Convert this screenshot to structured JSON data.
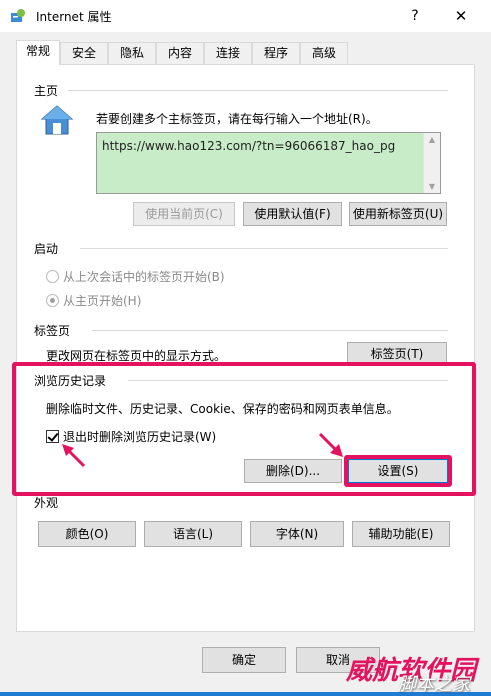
{
  "window": {
    "title": "Internet 属性",
    "help": "?",
    "close": "✕"
  },
  "tabs": [
    "常规",
    "安全",
    "隐私",
    "内容",
    "连接",
    "程序",
    "高级"
  ],
  "homepage": {
    "label": "主页",
    "instructions": "若要创建多个主标签页，请在每行输入一个地址(R)。",
    "url": "https://www.hao123.com/?tn=96066187_hao_pg",
    "btn_current": "使用当前页(C)",
    "btn_default": "使用默认值(F)",
    "btn_newtab": "使用新标签页(U)"
  },
  "startup": {
    "label": "启动",
    "opt1": "从上次会话中的标签页开始(B)",
    "opt2": "从主页开始(H)"
  },
  "tabs_group": {
    "label": "标签页",
    "desc": "更改网页在标签页中的显示方式。",
    "btn": "标签页(T)"
  },
  "history": {
    "label": "浏览历史记录",
    "desc": "删除临时文件、历史记录、Cookie、保存的密码和网页表单信息。",
    "checkbox": "退出时删除浏览历史记录(W)",
    "btn_delete": "删除(D)...",
    "btn_settings": "设置(S)"
  },
  "appearance": {
    "label": "外观",
    "btn_colors": "颜色(O)",
    "btn_languages": "语言(L)",
    "btn_fonts": "字体(N)",
    "btn_accessibility": "辅助功能(E)"
  },
  "footer": {
    "ok": "确定",
    "cancel": "取消"
  },
  "watermark": {
    "text1": "威航软件园",
    "text2": "脚本之家"
  },
  "colors": {
    "highlight": "#e5135f",
    "url_bg": "#c8ecc8"
  }
}
